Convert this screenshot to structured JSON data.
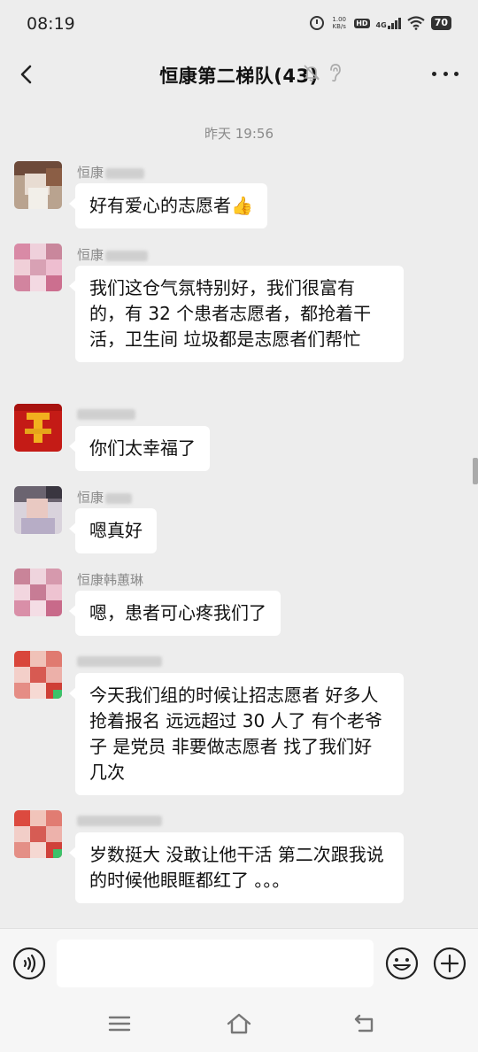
{
  "status": {
    "time": "08:19",
    "net_speed_value": "1.00",
    "net_speed_unit": "KB/s",
    "hd": "HD",
    "network": "4G",
    "battery": "70"
  },
  "header": {
    "title": "恒康第二梯队(43)"
  },
  "chat": {
    "timestamp": "昨天 19:56",
    "messages": [
      {
        "sender": "恒康",
        "text": "好有爱心的志愿者👍"
      },
      {
        "sender": "恒康",
        "text": "我们这仓气氛特别好，我们很富有的，有 32 个患者志愿者，都抢着干活，卫生间 垃圾都是志愿者们帮忙"
      },
      {
        "sender": "",
        "text": "你们太幸福了"
      },
      {
        "sender": "恒康",
        "text": "嗯真好"
      },
      {
        "sender": "恒康韩蕙琳",
        "text": "嗯，患者可心疼我们了"
      },
      {
        "sender": "",
        "text": "今天我们组的时候让招志愿者 好多人抢着报名 远远超过 30 人了 有个老爷子 是党员 非要做志愿者 找了我们好几次"
      },
      {
        "sender": "",
        "text": "岁数挺大 没敢让他干活 第二次跟我说的时候他眼眶都红了 。。。"
      }
    ]
  },
  "input": {
    "value": "",
    "placeholder": ""
  },
  "icons": {
    "back": "back-arrow-icon",
    "mute": "bell-muted-icon",
    "ear": "earpiece-icon",
    "more": "more-dots-icon",
    "voice": "voice-input-icon",
    "emoji": "emoji-icon",
    "plus": "plus-icon",
    "menu": "menu-icon",
    "home": "home-icon",
    "sys_back": "system-back-icon"
  },
  "colors": {
    "background": "#ededed",
    "bubble": "#ffffff",
    "meta_text": "#8a8a8a"
  }
}
